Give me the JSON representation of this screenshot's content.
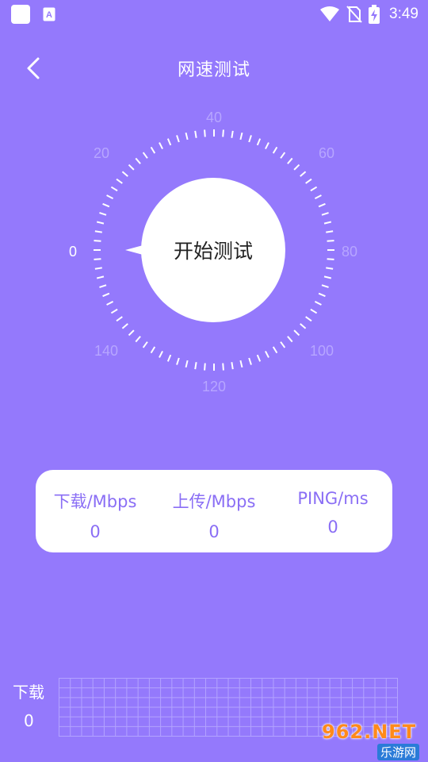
{
  "status_bar": {
    "time": "3:49",
    "icons": [
      "app-square-icon",
      "a-notification-icon",
      "wifi-icon",
      "no-sim-icon",
      "battery-charging-icon"
    ]
  },
  "header": {
    "title": "网速测试",
    "back_icon": "chevron-left-icon"
  },
  "gauge": {
    "ticks": [
      "0",
      "20",
      "40",
      "60",
      "80",
      "100",
      "120",
      "140"
    ],
    "needle_value": 0,
    "start_label": "开始测试"
  },
  "results": [
    {
      "label": "下载/Mbps",
      "value": "0"
    },
    {
      "label": "上传/Mbps",
      "value": "0"
    },
    {
      "label": "PING/ms",
      "value": "0"
    }
  ],
  "download_chart": {
    "label": "下载",
    "value": "0"
  },
  "watermark": {
    "main": "962.NET",
    "sub": "乐游网"
  },
  "colors": {
    "background": "#9479fc",
    "card": "#ffffff",
    "accent_text": "#8a6ef5"
  }
}
